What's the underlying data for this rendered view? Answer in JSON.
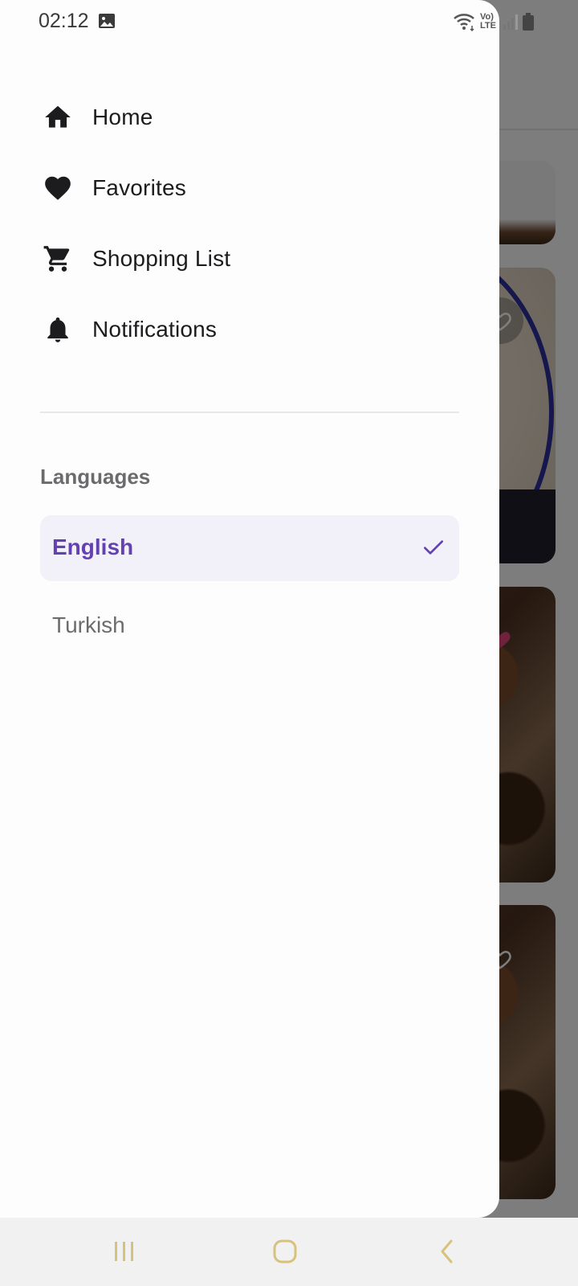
{
  "status_bar": {
    "time": "02:12",
    "icons": [
      "gallery-icon",
      "wifi-icon",
      "volte-indicator",
      "signal-icon",
      "battery-icon"
    ],
    "network_label": "Vo) LTE"
  },
  "drawer": {
    "nav_items": [
      {
        "label": "Home",
        "icon": "home-icon"
      },
      {
        "label": "Favorites",
        "icon": "heart-icon"
      },
      {
        "label": "Shopping List",
        "icon": "cart-icon"
      },
      {
        "label": "Notifications",
        "icon": "bell-icon"
      }
    ],
    "languages": {
      "heading": "Languages",
      "options": [
        {
          "label": "English",
          "selected": true
        },
        {
          "label": "Turkish",
          "selected": false
        }
      ]
    }
  },
  "nav_bar": {
    "buttons": [
      "recents-button",
      "home-button",
      "back-button"
    ]
  },
  "colors": {
    "accent": "#6441b1",
    "selected_bg": "#f2f0f8",
    "text_primary": "#1c1c1f",
    "text_secondary": "#6b6b6e",
    "nav_bar_icons": "#d6c27a",
    "favorite_active": "#e0457b"
  }
}
